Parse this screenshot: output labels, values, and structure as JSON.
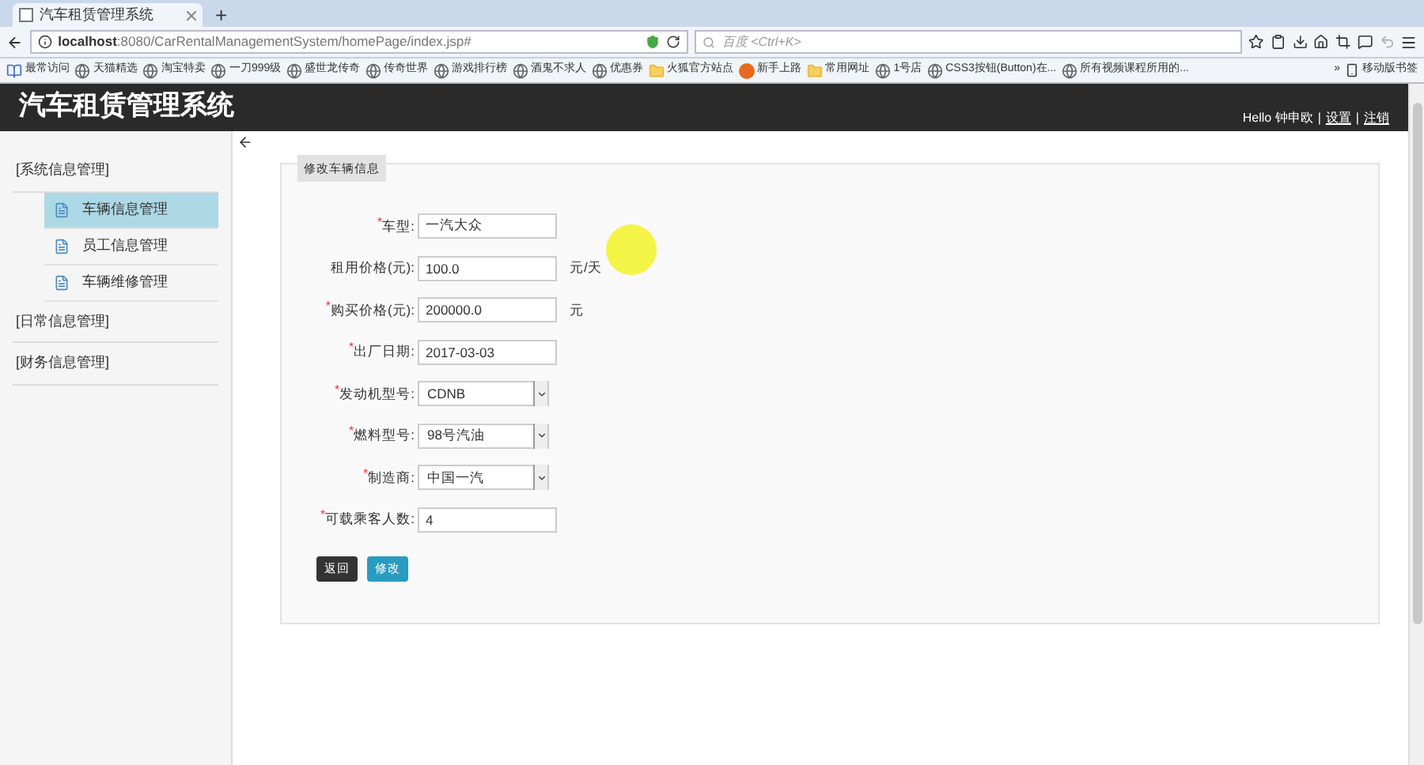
{
  "browser": {
    "tab_title": "汽车租赁管理系统",
    "new_tab": "+",
    "url_host": "localhost",
    "url_rest": ":8080/CarRentalManagementSystem/homePage/index.jsp#",
    "search_placeholder": "百度 <Ctrl+K>",
    "bookmarks": [
      {
        "label": "最常访问",
        "kind": "app"
      },
      {
        "label": "天猫精选",
        "kind": "globe"
      },
      {
        "label": "淘宝特卖",
        "kind": "globe"
      },
      {
        "label": "一刀999级",
        "kind": "globe"
      },
      {
        "label": "盛世龙传奇",
        "kind": "globe"
      },
      {
        "label": "传奇世界",
        "kind": "globe"
      },
      {
        "label": "游戏排行榜",
        "kind": "globe"
      },
      {
        "label": "酒鬼不求人",
        "kind": "globe"
      },
      {
        "label": "优惠券",
        "kind": "globe"
      },
      {
        "label": "火狐官方站点",
        "kind": "folder"
      },
      {
        "label": "新手上路",
        "kind": "fox"
      },
      {
        "label": "常用网址",
        "kind": "folder"
      },
      {
        "label": "1号店",
        "kind": "globe"
      },
      {
        "label": "CSS3按钮(Button)在...",
        "kind": "globe"
      },
      {
        "label": "所有视频课程所用的...",
        "kind": "globe"
      }
    ],
    "more": "»",
    "mobile_bookmarks": "移动版书签"
  },
  "header": {
    "title": "汽车租赁管理系统",
    "greeting": "Hello 钟申欧",
    "separator": "|",
    "links": [
      "设置",
      "注销"
    ]
  },
  "sidebar": {
    "groups": [
      {
        "label": "[系统信息管理]",
        "children": [
          {
            "label": "车辆信息管理",
            "selected": true
          },
          {
            "label": "员工信息管理",
            "selected": false
          },
          {
            "label": "车辆维修管理",
            "selected": false
          }
        ]
      },
      {
        "label": "[日常信息管理]"
      },
      {
        "label": "[财务信息管理]"
      }
    ]
  },
  "form": {
    "legend": "修改车辆信息",
    "fields": [
      {
        "label": "车型:",
        "required_mark": "*",
        "kind": "text",
        "value": "一汽大众"
      },
      {
        "label": "租用价格(元):",
        "kind": "text",
        "value": "100.0",
        "suffix": "元/天"
      },
      {
        "label": "购买价格(元):",
        "required_mark": "*",
        "kind": "text",
        "value": "200000.0",
        "suffix": "元"
      },
      {
        "label": "出厂日期:",
        "required_mark": "*",
        "kind": "text",
        "value": "2017-03-03"
      },
      {
        "label": "发动机型号:",
        "required_mark": "*",
        "kind": "select",
        "value": "CDNB"
      },
      {
        "label": "燃料型号:",
        "required_mark": "*",
        "kind": "select",
        "value": "98号汽油"
      },
      {
        "label": "制造商:",
        "required_mark": "*",
        "kind": "select",
        "value": "中国一汽"
      },
      {
        "label": "可载乘客人数:",
        "required_mark": "*",
        "kind": "text",
        "value": "4"
      }
    ],
    "buttons": [
      {
        "label": "返回",
        "kind": "dark"
      },
      {
        "label": "修改",
        "kind": "primary"
      }
    ]
  }
}
